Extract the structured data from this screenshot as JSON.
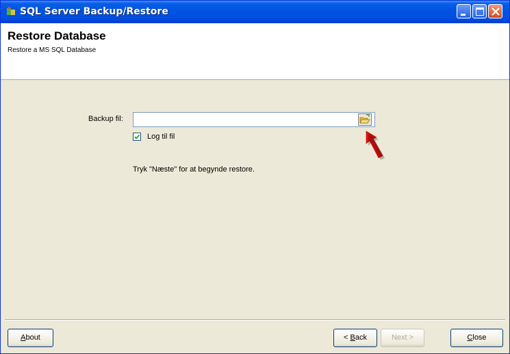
{
  "window": {
    "title": "SQL Server Backup/Restore"
  },
  "header": {
    "title": "Restore Database",
    "subtitle": "Restore a MS SQL Database"
  },
  "form": {
    "backup_file_label": "Backup fil:",
    "backup_file_value": "",
    "log_checkbox_label": "Log til fil",
    "log_checked": true,
    "instruction": "Tryk \"Næste\" for at begynde restore."
  },
  "buttons": {
    "about": {
      "first": "A",
      "rest": "bout"
    },
    "back": {
      "prefix": "< ",
      "first": "B",
      "rest": "ack"
    },
    "next": {
      "label": "Next >"
    },
    "close": {
      "first": "C",
      "rest": "lose"
    }
  },
  "colors": {
    "titlebar": "#0054e3",
    "annotation_arrow": "#e81010"
  },
  "icons": [
    "app-icon",
    "minimize-icon",
    "maximize-icon",
    "close-icon",
    "folder-open-icon",
    "red-arrow-annotation"
  ]
}
